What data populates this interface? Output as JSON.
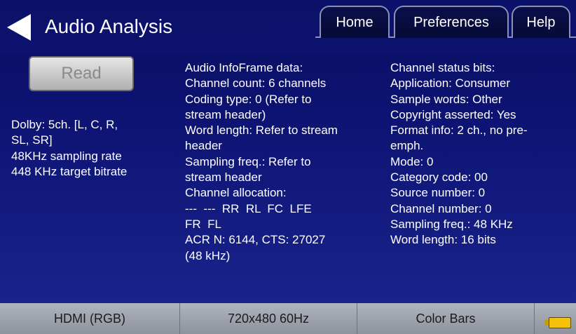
{
  "header": {
    "title": "Audio Analysis",
    "tabs": [
      "Home",
      "Preferences",
      "Help"
    ]
  },
  "read_button": "Read",
  "dolby_info": [
    "Dolby: 5ch. [L, C, R,",
    "SL, SR]",
    "48KHz sampling rate",
    "448 KHz target bitrate"
  ],
  "infoframe": [
    "Audio InfoFrame data:",
    "Channel count: 6 channels",
    "Coding type: 0 (Refer to",
    "stream header)",
    "Word length: Refer to stream",
    "header",
    "Sampling freq.: Refer to",
    "stream header",
    "Channel allocation:",
    "---  ---  RR  RL  FC  LFE",
    "FR  FL",
    "ACR N: 6144, CTS: 27027",
    "(48 kHz)"
  ],
  "channel_status": [
    "Channel status bits:",
    "Application: Consumer",
    "Sample words: Other",
    "Copyright asserted: Yes",
    "Format info: 2 ch., no pre-",
    "emph.",
    "Mode: 0",
    "Category code: 00",
    "Source number: 0",
    "Channel number: 0",
    "Sampling freq.: 48 KHz",
    "Word length: 16 bits"
  ],
  "footer": {
    "video_interface": "HDMI (RGB)",
    "resolution": "720x480 60Hz",
    "pattern": "Color Bars",
    "battery_icon": "battery-icon"
  },
  "colors": {
    "background": "#0c1270",
    "battery": "#f3c20a"
  }
}
